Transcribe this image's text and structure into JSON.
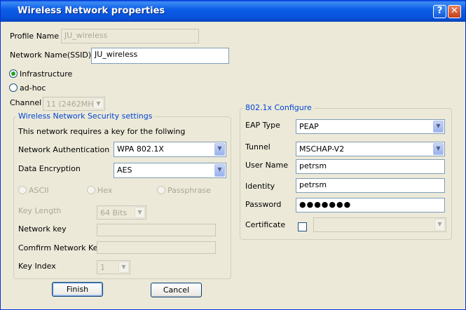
{
  "window": {
    "title": "Wireless Network properties",
    "help_label": "?",
    "close_label": "✕"
  },
  "profile": {
    "name_label": "Profile Name",
    "name_value": "JU_wireless",
    "ssid_label": "Network Name(SSID)",
    "ssid_value": "JU_wireless"
  },
  "mode": {
    "infrastructure_label": "Infrastructure",
    "adhoc_label": "ad-hoc",
    "selected": "Infrastructure"
  },
  "channel": {
    "label": "Channel",
    "value": "11 (2462MHz)"
  },
  "security": {
    "legend": "Wireless Network Security settings",
    "note": "This network requires a key for the follwing",
    "auth_label": "Network Authentication",
    "auth_value": "WPA 802.1X",
    "enc_label": "Data Encryption",
    "enc_value": "AES",
    "ascii_label": "ASCII",
    "hex_label": "Hex",
    "pass_label": "Passphrase",
    "keylen_label": "Key Length",
    "keylen_value": "64 Bits",
    "netkey_label": "Network key",
    "confirm_label": "Comfirm Network Key",
    "keyindex_label": "Key Index",
    "keyindex_value": "1"
  },
  "dot1x": {
    "legend": "802.1x Configure",
    "eap_label": "EAP Type",
    "eap_value": "PEAP",
    "tunnel_label": "Tunnel",
    "tunnel_value": "MSCHAP-V2",
    "user_label": "User Name",
    "user_value": "petrsm",
    "identity_label": "Identity",
    "identity_value": "petrsm",
    "password_label": "Password",
    "password_value": "●●●●●●●",
    "cert_label": "Certificate",
    "cert_value": ""
  },
  "buttons": {
    "finish": "Finish",
    "cancel": "Cancel"
  },
  "colors": {
    "title_bar": "#0A5FE5",
    "group_legend": "#0046D5",
    "window_bg": "#ECE9D8"
  }
}
